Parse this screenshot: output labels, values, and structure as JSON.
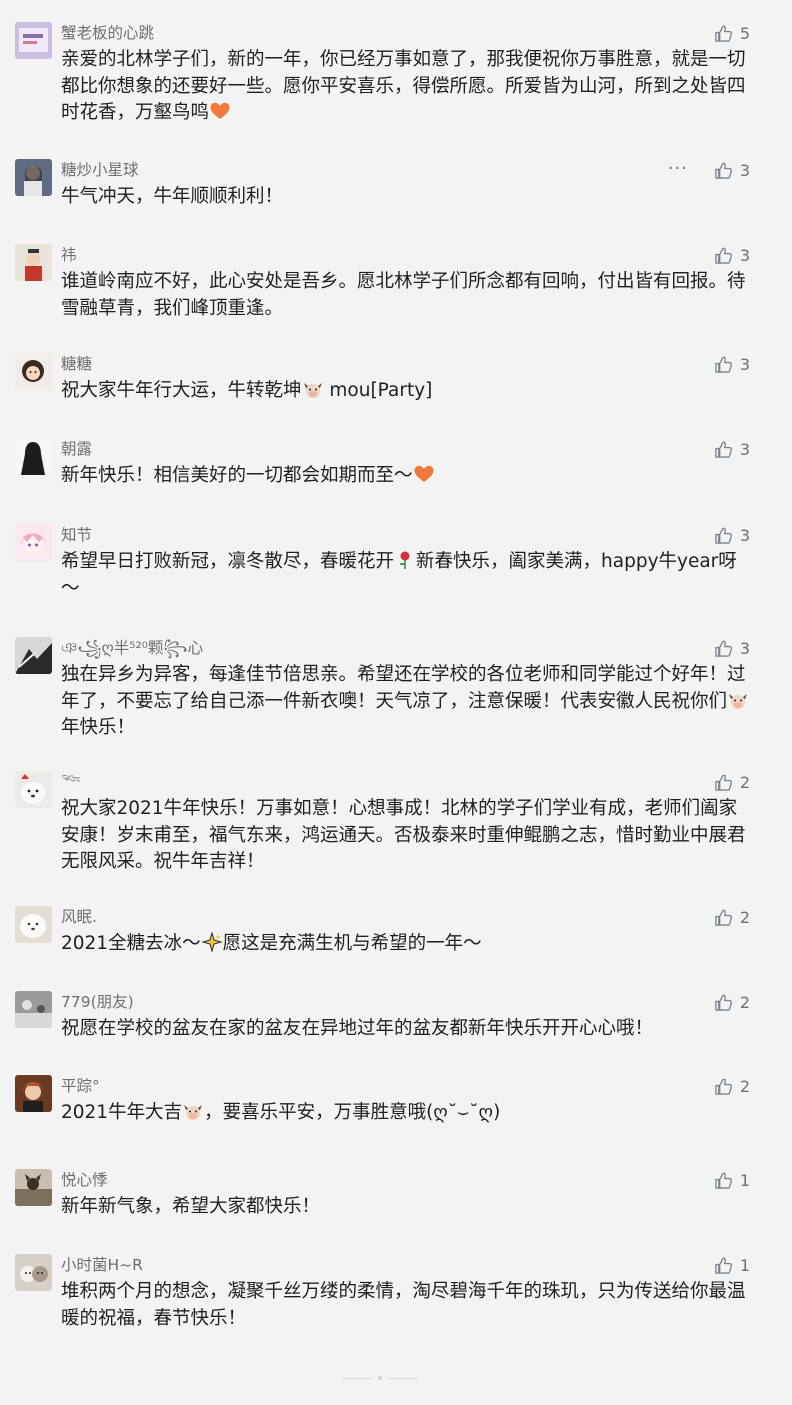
{
  "comments": [
    {
      "nickname": "蟹老板的心跳",
      "likes": "5",
      "avatar_color": "#b7a3c8",
      "text": "亲爱的北林学子们，新的一年，你已经万事如意了，那我便祝你万事胜意，就是一切都比你想象的还要好一些。愿你平安喜乐，得偿所愿。所爱皆为山河，所到之处皆四时花香，万壑鸟鸣",
      "emoji_after": "heart-emoji"
    },
    {
      "nickname": "糖炒小星球",
      "likes": "3",
      "avatar_color": "#6b7588",
      "more_label": "···",
      "text": "牛气冲天，牛年顺顺利利！"
    },
    {
      "nickname": "祎",
      "likes": "3",
      "avatar_color": "#c0392b",
      "text": "谁道岭南应不好，此心安处是吾乡。愿北林学子们所念都有回响，付出皆有回报。待雪融草青，我们峰顶重逢。"
    },
    {
      "nickname": "糖糖",
      "likes": "3",
      "avatar_color": "#c9a27c",
      "text_before": "祝大家牛年行大运，牛转乾坤",
      "text_after": " mou[Party]",
      "emoji_mid": "cow-emoji"
    },
    {
      "nickname": "朝露",
      "likes": "3",
      "avatar_color": "#2a2a2a",
      "text": "新年快乐！相信美好的一切都会如期而至～",
      "emoji_after": "heart-emoji"
    },
    {
      "nickname": "知节",
      "likes": "3",
      "avatar_color": "#f2b6c8",
      "text_before": "希望早日打败新冠，凛冬散尽，春暖花开",
      "text_after": "新春快乐，阖家美满，happy牛year呀～",
      "emoji_mid": "rose-emoji"
    },
    {
      "nickname": "ঞ꧁ღ半⁵²⁰颗꧂心",
      "likes": "3",
      "avatar_color": "#3b3b3b",
      "text_before": "独在异乡为异客，每逢佳节倍思亲。希望还在学校的各位老师和同学能过个好年！过年了，不要忘了给自己添一件新衣噢！天气凉了，注意保暖！代表安徽人民祝你们",
      "text_after": "年快乐！",
      "emoji_mid": "cow-emoji"
    },
    {
      "nickname": "𓆝",
      "likes": "2",
      "avatar_color": "#e9e6e2",
      "text": "祝大家2021牛年快乐！万事如意！心想事成！北林的学子们学业有成，老师们阖家安康！岁末甫至，福气东来，鸿运通天。否极泰来时重伸鲲鹏之志，惜时勤业中展君无限风采。祝牛年吉祥！"
    },
    {
      "nickname": "风眠.",
      "likes": "2",
      "avatar_color": "#e8e3dc",
      "text_before": "2021全糖去冰～",
      "text_after": "愿这是充满生机与希望的一年～",
      "emoji_mid": "sparkle-emoji"
    },
    {
      "nickname": "779(朋友)",
      "likes": "2",
      "avatar_color": "#8a8a8a",
      "text": "祝愿在学校的盆友在家的盆友在异地过年的盆友都新年快乐开开心心哦！"
    },
    {
      "nickname": "平踪°",
      "likes": "2",
      "avatar_color": "#8b4a2a",
      "text_before": "2021牛年大吉",
      "text_after": "，要喜乐平安，万事胜意哦(ღ˘⌣˘ღ)",
      "emoji_mid": "cow-emoji"
    },
    {
      "nickname": "悦心悸",
      "likes": "1",
      "avatar_color": "#9a8a78",
      "text": "新年新气象，希望大家都快乐！"
    },
    {
      "nickname": "小时菌H~R",
      "likes": "1",
      "avatar_color": "#b8b0a6",
      "text": "堆积两个月的想念，凝聚千丝万缕的柔情，淘尽碧海千年的珠玑，只为传送给你最温暖的祝福，春节快乐！"
    }
  ]
}
